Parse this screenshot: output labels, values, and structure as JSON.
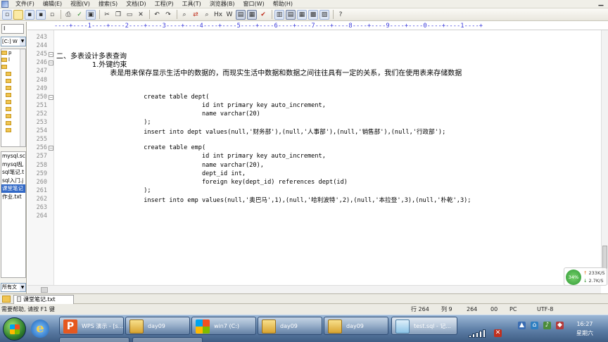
{
  "menubar": {
    "items": [
      "文件(F)",
      "编辑(E)",
      "视图(V)",
      "搜索(S)",
      "文档(D)",
      "工程(P)",
      "工具(T)",
      "浏览器(B)",
      "窗口(W)",
      "帮助(H)"
    ],
    "minimize_glyph": "▁"
  },
  "toolbar": {
    "icons": [
      "new-file",
      "open-folder",
      "save",
      "save-all",
      "close-doc",
      "print",
      "spell-check",
      "view-toggle",
      "cut",
      "copy",
      "paste",
      "delete",
      "undo",
      "redo",
      "find",
      "replace",
      "find-in-files",
      "hex-edit",
      "word-wrap",
      "column-mode",
      "spell",
      "column-view",
      "list",
      "tile",
      "grid",
      "image",
      "help"
    ],
    "hex_label": "Hx",
    "wrap_label": "W"
  },
  "sidebar": {
    "tab_label": "I",
    "drive_select": "[C:] W",
    "tree_items": [
      "p",
      "l",
      "",
      "",
      "",
      "",
      "",
      "",
      "",
      "",
      "",
      "",
      ""
    ],
    "files": [
      "mysql.sc",
      "mysql乱",
      "sql笔记.t",
      "sql入门.j",
      "课堂笔记",
      "作业.txt"
    ],
    "selected_file_index": 4,
    "filter_select": "所有文"
  },
  "ruler": {
    "text": "----+----1----+----2----+----3----+----4----+----5----+----6----+----7----+----8----+----9----+----0----+----1----+"
  },
  "editor": {
    "lines": [
      {
        "num": "243",
        "text": "",
        "fold": ""
      },
      {
        "num": "244",
        "text": "",
        "fold": ""
      },
      {
        "num": "245",
        "text": "二、多表设计多表查询",
        "fold": "−",
        "cn": true
      },
      {
        "num": "246",
        "text": "\t\t1.外键约束",
        "fold": "−",
        "cn": true
      },
      {
        "num": "247",
        "text": "\t\t\t表是用来保存显示生活中的数据的，而现实生活中数据和数据之间往往具有一定的关系，我们在使用表来存储数据",
        "fold": "",
        "cn": true
      },
      {
        "num": "248",
        "text": "",
        "fold": ""
      },
      {
        "num": "249",
        "text": "",
        "fold": ""
      },
      {
        "num": "250",
        "text": "\t\t\tcreate table dept(",
        "fold": "−"
      },
      {
        "num": "251",
        "text": "\t\t\t\t\tid int primary key auto_increment,",
        "fold": ""
      },
      {
        "num": "252",
        "text": "\t\t\t\t\tname varchar(20)",
        "fold": ""
      },
      {
        "num": "253",
        "text": "\t\t\t);",
        "fold": ""
      },
      {
        "num": "254",
        "text": "\t\t\tinsert into dept values(null,'财务部'),(null,'人事部'),(null,'销售部'),(null,'行政部');",
        "fold": ""
      },
      {
        "num": "255",
        "text": "",
        "fold": ""
      },
      {
        "num": "256",
        "text": "\t\t\tcreate table emp(",
        "fold": "−"
      },
      {
        "num": "257",
        "text": "\t\t\t\t\tid int primary key auto_increment,",
        "fold": ""
      },
      {
        "num": "258",
        "text": "\t\t\t\t\tname varchar(20),",
        "fold": ""
      },
      {
        "num": "259",
        "text": "\t\t\t\t\tdept_id int,",
        "fold": ""
      },
      {
        "num": "260",
        "text": "\t\t\t\t\tforeign key(dept_id) references dept(id)",
        "fold": ""
      },
      {
        "num": "261",
        "text": "\t\t\t);",
        "fold": ""
      },
      {
        "num": "262",
        "text": "\t\t\tinsert into emp values(null,'奥巴马',1),(null,'哈利波特',2),(null,'本拉登',3),(null,'朴乾',3);",
        "fold": ""
      },
      {
        "num": "263",
        "text": "",
        "fold": ""
      },
      {
        "num": "264",
        "text": "",
        "fold": ""
      }
    ]
  },
  "netwidget": {
    "percent": "34%",
    "upload": "233K/S",
    "download": "2.7K/S",
    "up_arrow": "↑",
    "down_arrow": "↓"
  },
  "tabbar": {
    "doc_tab": "课堂笔记.txt"
  },
  "statusbar": {
    "help": "需要帮助, 请按 F1 键",
    "row": "行 264",
    "col": "列 9",
    "num": "264",
    "num2": "00",
    "mode": "PC",
    "encoding": "UTF-8"
  },
  "taskbar": {
    "buttons": [
      {
        "label": "WPS 演示 - [s...",
        "icon": "wps-icon",
        "glyph": "P"
      },
      {
        "label": "day09",
        "icon": "folder-icon"
      },
      {
        "label": "win7 (C:)",
        "icon": "windows-icon"
      },
      {
        "label": "day09",
        "icon": "folder-icon"
      },
      {
        "label": "day09",
        "icon": "folder-icon"
      },
      {
        "label": "test.sql - 记...",
        "icon": "notepad-icon"
      }
    ],
    "ie_glyph": "e",
    "clock_time": "16:27",
    "clock_day": "星期六"
  },
  "colors": {
    "taskbar_top": "#9bb7d6",
    "taskbar_bottom": "#3f5d84",
    "selection": "#3168c6",
    "ruler": "#3a3adb"
  }
}
